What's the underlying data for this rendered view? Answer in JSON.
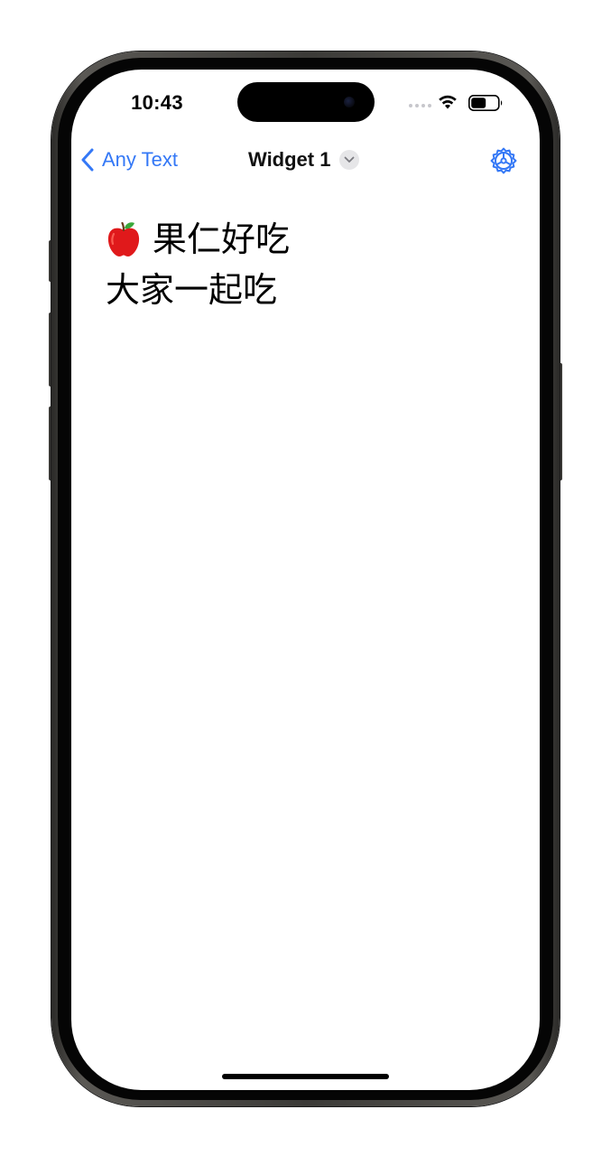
{
  "status_bar": {
    "time": "10:43",
    "icons": [
      "signal-dots-icon",
      "wifi-icon",
      "battery-icon"
    ]
  },
  "nav": {
    "back_label": "Any Text",
    "title": "Widget 1",
    "icons": [
      "chevron-left-icon",
      "chevron-down-icon",
      "gear-icon"
    ]
  },
  "content": {
    "line1_text": "果仁好吃",
    "line1_icon": "red-apple-icon",
    "line2_text": "大家一起吃"
  },
  "colors": {
    "accent": "#3478f6",
    "text": "#000000",
    "background": "#ffffff",
    "frame": "#3b3a37"
  }
}
